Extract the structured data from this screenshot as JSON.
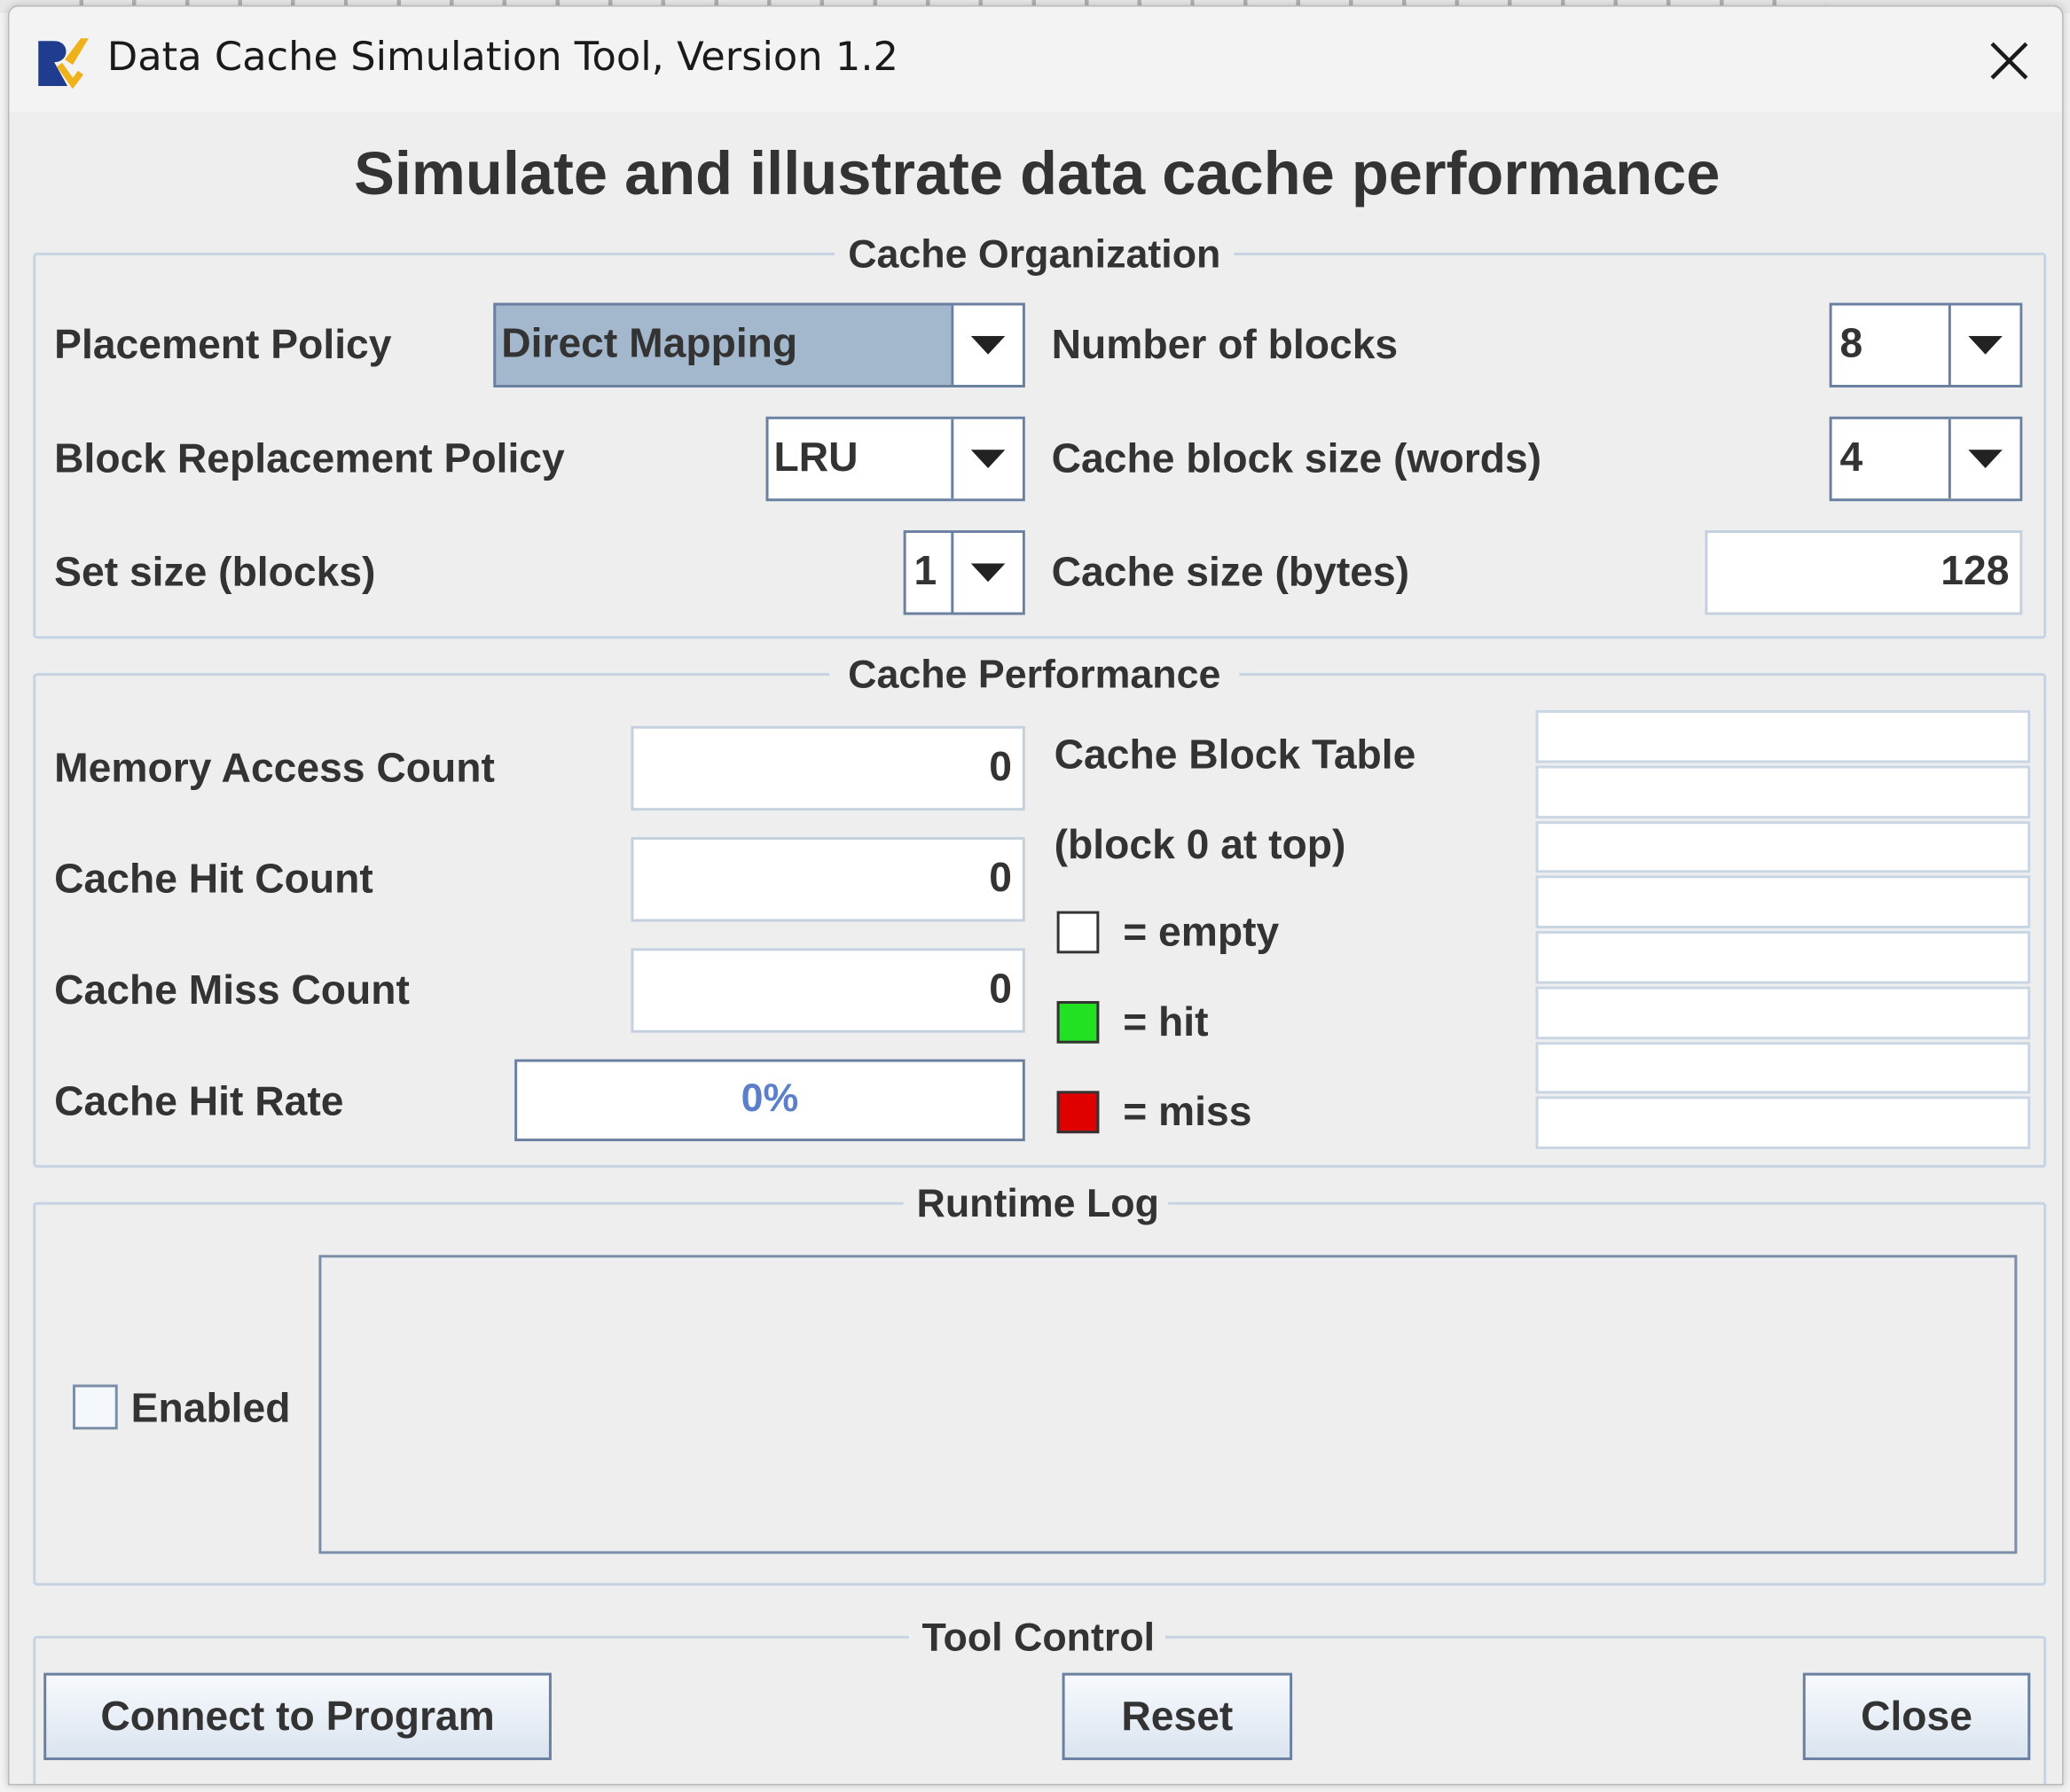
{
  "window": {
    "title": "Data Cache Simulation Tool, Version 1.2",
    "heading": "Simulate and illustrate data cache performance"
  },
  "cache_organization": {
    "title": "Cache Organization",
    "placement_policy": {
      "label": "Placement Policy",
      "value": "Direct Mapping"
    },
    "replacement_policy": {
      "label": "Block Replacement Policy",
      "value": "LRU"
    },
    "set_size": {
      "label": "Set size (blocks)",
      "value": "1"
    },
    "num_blocks": {
      "label": "Number of blocks",
      "value": "8"
    },
    "block_size": {
      "label": "Cache block size (words)",
      "value": "4"
    },
    "cache_size": {
      "label": "Cache size (bytes)",
      "value": "128"
    }
  },
  "cache_performance": {
    "title": "Cache Performance",
    "memory_access_count": {
      "label": "Memory Access Count",
      "value": "0"
    },
    "hit_count": {
      "label": "Cache Hit Count",
      "value": "0"
    },
    "miss_count": {
      "label": "Cache Miss Count",
      "value": "0"
    },
    "hit_rate": {
      "label": "Cache Hit Rate",
      "value": "0%",
      "fraction": 0.0
    },
    "block_table": {
      "label": "Cache Block Table",
      "sublabel": "(block 0 at top)",
      "rows": 8
    },
    "legend": {
      "empty": {
        "label": "= empty",
        "color": "#ffffff"
      },
      "hit": {
        "label": "= hit",
        "color": "#22e022"
      },
      "miss": {
        "label": "= miss",
        "color": "#e00000"
      }
    }
  },
  "runtime_log": {
    "title": "Runtime Log",
    "enabled_label": "Enabled",
    "enabled": false
  },
  "tool_control": {
    "title": "Tool Control",
    "connect_label": "Connect to Program",
    "reset_label": "Reset",
    "close_label": "Close"
  }
}
